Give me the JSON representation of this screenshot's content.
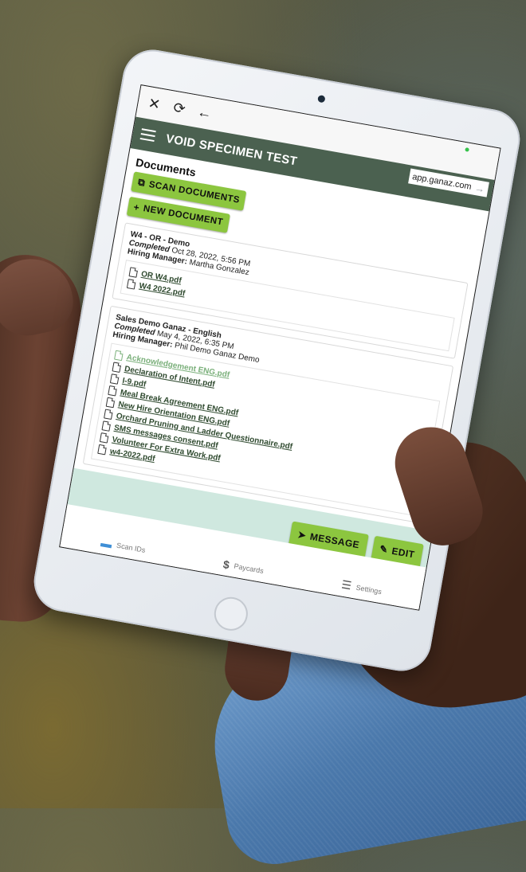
{
  "browser": {
    "close_icon": "close-icon",
    "reload_icon": "reload-icon",
    "back_icon": "back-arrow-icon",
    "domain": "app.ganaz.com"
  },
  "header": {
    "title": "VOID SPECIMEN TEST"
  },
  "documents": {
    "title": "Documents",
    "scan_label": "SCAN DOCUMENTS",
    "new_label": "NEW DOCUMENT"
  },
  "packets": [
    {
      "name": "W4 - OR - Demo",
      "status": "Completed",
      "date": "Oct 28, 2022, 5:56 PM",
      "manager_label": "Hiring Manager:",
      "manager": "Martha Gonzalez",
      "files": [
        "OR W4.pdf",
        "W4 2022.pdf"
      ]
    },
    {
      "name": "Sales Demo Ganaz - English",
      "status": "Completed",
      "date": "May 4, 2022, 6:35 PM",
      "manager_label": "Hiring Manager:",
      "manager": "Phil Demo Ganaz Demo",
      "files": [
        "Acknowledgement ENG.pdf",
        "Declaration of Intent.pdf",
        "I-9.pdf",
        "Meal Break Agreement ENG.pdf",
        "New Hire Orientation ENG.pdf",
        "Orchard Pruning and Ladder Questionnaire.pdf",
        "SMS messages consent.pdf",
        "Volunteer For Extra Work.pdf",
        "w4-2022.pdf"
      ]
    }
  ],
  "actions": {
    "message_label": "MESSAGE",
    "edit_label": "EDIT"
  },
  "nav": {
    "scan_ids": "Scan IDs",
    "paycards": "Paycards",
    "settings": "Settings"
  },
  "colors": {
    "header_green": "#4b6150",
    "button_green": "#8cc63f",
    "mint_band": "#cfe8df",
    "link_green": "#2f4a2f"
  }
}
